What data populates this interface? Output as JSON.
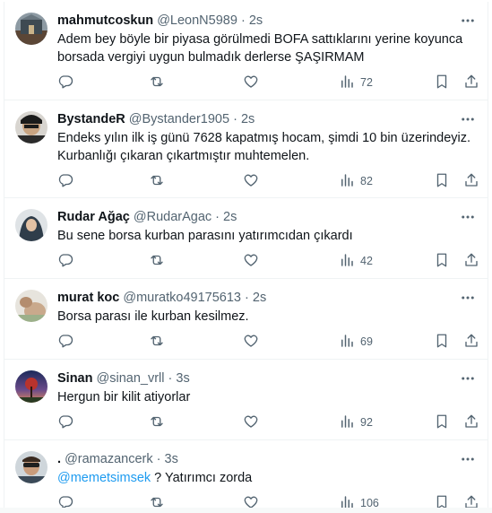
{
  "tweets": [
    {
      "name": "mahmutcoskun",
      "handle": "@LeonN5989",
      "dot": "·",
      "time": "2s",
      "text": "Adem bey böyle bir piyasa görülmedi BOFA sattıklarını yerine koyunca borsada vergiyi uygun bulmadık derlerse ŞAŞIRMAM",
      "views": "72"
    },
    {
      "name": "BystandeR",
      "handle": "@Bystander1905",
      "dot": "·",
      "time": "2s",
      "text": "Endeks yılın ilk iş günü 7628 kapatmış hocam, şimdi 10 bin üzerindeyiz. Kurbanlığı çıkaran çıkartmıştır muhtemelen.",
      "views": "82"
    },
    {
      "name": "Rudar Ağaç",
      "handle": "@RudarAgac",
      "dot": "·",
      "time": "2s",
      "text": "Bu sene borsa kurban parasını yatırımcıdan çıkardı",
      "views": "42"
    },
    {
      "name": "murat koc",
      "handle": "@muratko49175613",
      "dot": "·",
      "time": "2s",
      "text": "Borsa parası ile kurban kesilmez.",
      "views": "69"
    },
    {
      "name": "Sinan",
      "handle": "@sinan_vrll",
      "dot": "·",
      "time": "3s",
      "text": "Hergun bir kilit atiyorlar",
      "views": "92"
    },
    {
      "name": ".",
      "handle": "@ramazancerk",
      "dot": "·",
      "time": "3s",
      "mention": "@memetsimsek",
      "text": " ? Yatırımcı zorda",
      "views": "106"
    }
  ],
  "icons": {
    "more": "more-horizontal-icon",
    "reply": "reply-icon",
    "retweet": "retweet-icon",
    "like": "heart-icon",
    "views": "views-chart-icon",
    "bookmark": "bookmark-icon",
    "share": "share-icon"
  },
  "colors": {
    "text": "#0f1419",
    "secondary": "#536471",
    "link": "#1d9bf0",
    "divider": "#eff3f4"
  }
}
